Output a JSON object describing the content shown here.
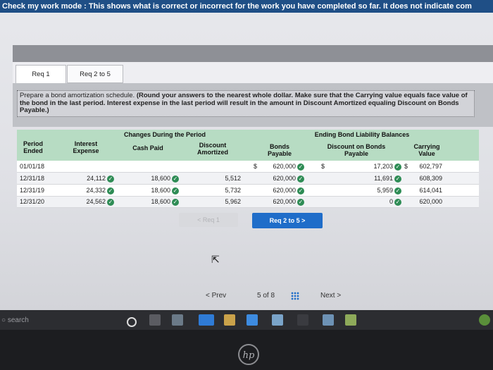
{
  "banner": {
    "text": "Check my work mode : This shows what is correct or incorrect for the work you have completed so far. It does not indicate com"
  },
  "tabs": [
    {
      "label": "Req 1",
      "active": true
    },
    {
      "label": "Req 2 to 5",
      "active": false
    }
  ],
  "instructions": {
    "prefix": "Prepare a bond amortization schedule.",
    "bold": "(Round your answers to the nearest whole dollar. Make sure that the Carrying value equals face value of the bond in the last period. Interest expense in the last period will result in the amount in Discount Amortized equaling Discount on Bonds Payable.)"
  },
  "table": {
    "group_headers": {
      "changes": "Changes During the Period",
      "ending": "Ending Bond Liability Balances"
    },
    "columns": {
      "period": "Period Ended",
      "interest": "Interest Expense",
      "cash": "Cash Paid",
      "discount_amortized": "Discount Amortized",
      "bonds": "Bonds Payable",
      "discount_on": "Discount on Bonds Payable",
      "carrying": "Carrying Value"
    },
    "currency": "$",
    "rows": [
      {
        "period": "01/01/18",
        "interest": "",
        "cash": "",
        "amortized": "",
        "bonds": "620,000",
        "discount": "17,203",
        "carrying": "602,797"
      },
      {
        "period": "12/31/18",
        "interest": "24,112",
        "cash": "18,600",
        "amortized": "5,512",
        "bonds": "620,000",
        "discount": "11,691",
        "carrying": "608,309"
      },
      {
        "period": "12/31/19",
        "interest": "24,332",
        "cash": "18,600",
        "amortized": "5,732",
        "bonds": "620,000",
        "discount": "5,959",
        "carrying": "614,041"
      },
      {
        "period": "12/31/20",
        "interest": "24,562",
        "cash": "18,600",
        "amortized": "5,962",
        "bonds": "620,000",
        "discount": "0",
        "carrying": "620,000"
      }
    ]
  },
  "buttons": {
    "prev_req": "< Req 1",
    "next_req": "Req 2 to 5  >"
  },
  "pager": {
    "prev": "< Prev",
    "current": "5",
    "of": "of",
    "total": "8",
    "next": "Next >"
  },
  "taskbar": {
    "search": "search"
  },
  "brand": "hp",
  "colors": {
    "header_green": "#b7dcc3",
    "check_green": "#2e8c55",
    "primary_blue": "#1f6dc9"
  }
}
